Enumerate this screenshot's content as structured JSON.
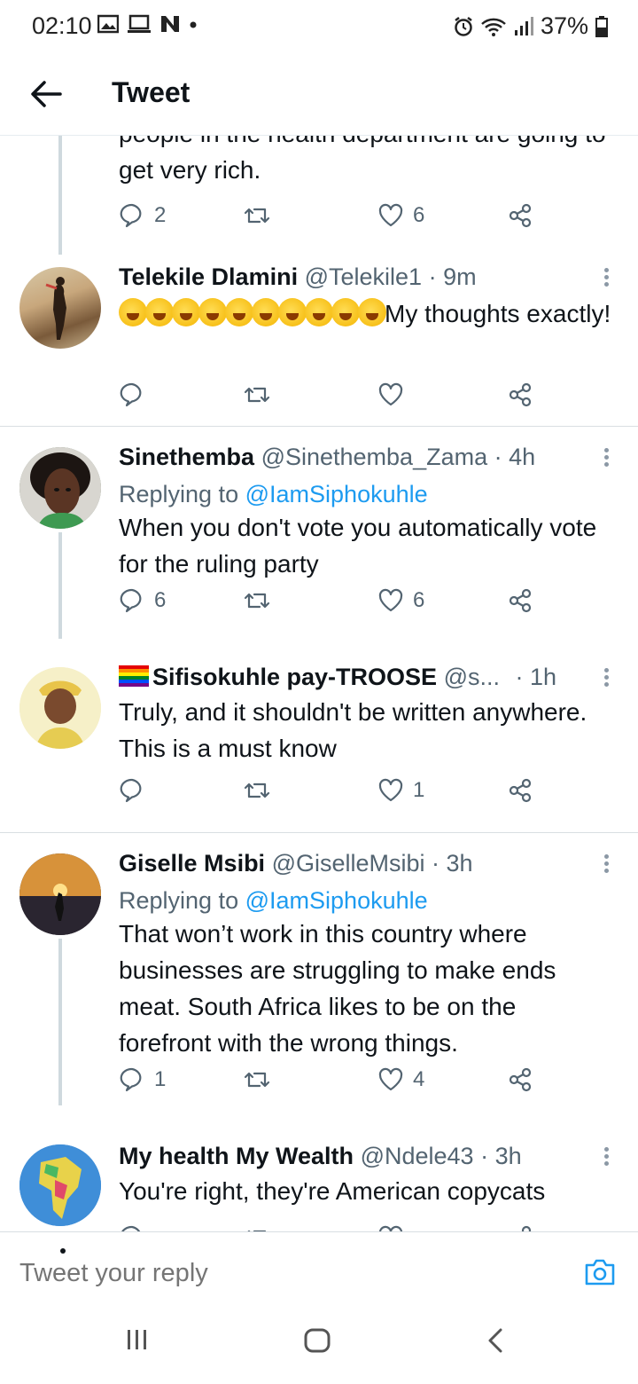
{
  "status_bar": {
    "time": "02:10",
    "left_icons": [
      "gallery-icon",
      "screen-icon",
      "n-icon",
      "dot-icon"
    ],
    "right_icons": [
      "alarm-icon",
      "wifi-icon",
      "signal-icon"
    ],
    "battery": "37%"
  },
  "header": {
    "title": "Tweet",
    "back_icon": "arrow-left-icon"
  },
  "tweets": [
    {
      "body": "people in the health department are going to get very rich.",
      "reply_count": "2",
      "retweet_count": "",
      "like_count": "6"
    },
    {
      "name": "Telekile Dlamini",
      "handle": "@Telekile1",
      "time": "· 9m",
      "body": "My thoughts exactly!",
      "emoji_count": 10,
      "reply_count": "",
      "retweet_count": "",
      "like_count": ""
    },
    {
      "name": "Sinethemba",
      "handle": "@Sinethemba_Zama",
      "time": "· 4h",
      "replying_prefix": "Replying to",
      "replying_to": "@IamSiphokuhle",
      "body": "When you don't vote you automatically vote for the ruling party",
      "reply_count": "6",
      "retweet_count": "",
      "like_count": "6"
    },
    {
      "name": "Sifisokuhle pay-TROOSE",
      "handle": "@s...",
      "time": "· 1h",
      "body": "Truly, and it shouldn't be written anywhere. This is a must know",
      "reply_count": "",
      "retweet_count": "",
      "like_count": "1"
    },
    {
      "name": "Giselle Msibi",
      "handle": "@GiselleMsibi",
      "time": "· 3h",
      "replying_prefix": "Replying to",
      "replying_to": "@IamSiphokuhle",
      "body": "That won’t work in this country where businesses are struggling to make ends meat. South Africa likes to be on the forefront with the wrong things.",
      "reply_count": "1",
      "retweet_count": "",
      "like_count": "4"
    },
    {
      "name": "My health My Wealth",
      "handle": "@Ndele43",
      "time": "· 3h",
      "body": "You're right, they're American copycats"
    }
  ],
  "composer": {
    "placeholder": "Tweet your reply",
    "camera_icon": "camera-icon"
  },
  "nav": {
    "icons": [
      "recents-icon",
      "home-icon",
      "back-icon"
    ]
  },
  "colors": {
    "link": "#1d9bf0",
    "secondary": "#536471",
    "text": "#0f1419"
  }
}
